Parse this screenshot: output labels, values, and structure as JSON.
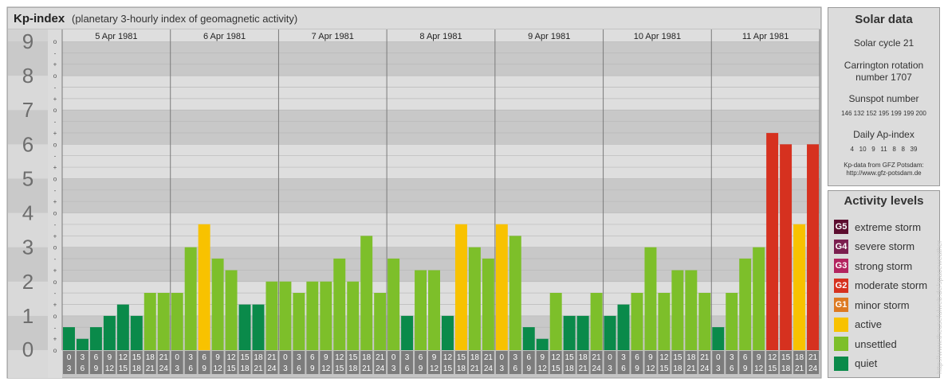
{
  "title": "Kp-index",
  "subtitle": "(planetary 3-hourly index of geomagnetic activity)",
  "chart_data": {
    "type": "bar",
    "ylim": [
      0,
      9
    ],
    "y_ticks": [
      "0",
      "1",
      "2",
      "3",
      "4",
      "5",
      "6",
      "7",
      "8",
      "9"
    ],
    "minor_ticks": [
      "-",
      "o",
      "+"
    ],
    "days": [
      "5 Apr 1981",
      "6 Apr 1981",
      "7 Apr 1981",
      "8 Apr 1981",
      "9 Apr 1981",
      "10 Apr 1981",
      "11 Apr 1981"
    ],
    "interval_start_labels": [
      "0",
      "3",
      "6",
      "9",
      "12",
      "15",
      "18",
      "21"
    ],
    "interval_end_labels": [
      "3",
      "6",
      "9",
      "12",
      "15",
      "18",
      "21",
      "24"
    ],
    "values": [
      0.67,
      0.33,
      0.67,
      1.0,
      1.33,
      1.0,
      1.67,
      1.67,
      1.67,
      3.0,
      3.67,
      2.67,
      2.33,
      1.33,
      1.33,
      2.0,
      2.0,
      1.67,
      2.0,
      2.0,
      2.67,
      2.0,
      3.33,
      1.67,
      2.67,
      1.0,
      2.33,
      2.33,
      1.0,
      3.67,
      3.0,
      2.67,
      3.67,
      3.33,
      0.67,
      0.33,
      1.67,
      1.0,
      1.0,
      1.67,
      1.0,
      1.33,
      1.67,
      3.0,
      1.67,
      2.33,
      2.33,
      1.67,
      0.67,
      1.67,
      2.67,
      3.0,
      6.33,
      6.0,
      3.67,
      6.0
    ]
  },
  "colors": {
    "extreme": "#5c0e2f",
    "severe": "#7b1f4f",
    "strong": "#b3245f",
    "moderate": "#d6311f",
    "minor": "#dd7a22",
    "active": "#f8c200",
    "unsettled": "#7dbf2a",
    "quiet": "#0a8a4a"
  },
  "solar": {
    "title": "Solar data",
    "cycle": "Solar cycle 21",
    "carrington_1": "Carrington rotation",
    "carrington_2": "number 1707",
    "sunspot_title": "Sunspot number",
    "sunspot_values": "146 132 152 195 199 199 200",
    "ap_title": "Daily Ap-index",
    "ap_values": "4   10   9   11   8   8   39",
    "source_1": "Kp-data from GFZ Potsdam:",
    "source_2": "http://www.gfz-potsdam.de"
  },
  "legend": {
    "title": "Activity levels",
    "items": [
      {
        "badge": "G5",
        "label": "extreme storm",
        "color": "#5c0e2f"
      },
      {
        "badge": "G4",
        "label": "severe storm",
        "color": "#7b1f4f"
      },
      {
        "badge": "G3",
        "label": "strong storm",
        "color": "#b3245f"
      },
      {
        "badge": "G2",
        "label": "moderate storm",
        "color": "#d6311f"
      },
      {
        "badge": "G1",
        "label": "minor storm",
        "color": "#dd7a22"
      },
      {
        "badge": "",
        "label": "active",
        "color": "#f8c200"
      },
      {
        "badge": "",
        "label": "unsettled",
        "color": "#7dbf2a"
      },
      {
        "badge": "",
        "label": "quiet",
        "color": "#0a8a4a"
      }
    ]
  },
  "watermark": "http://www.theusefulweb.de/spaceweather"
}
